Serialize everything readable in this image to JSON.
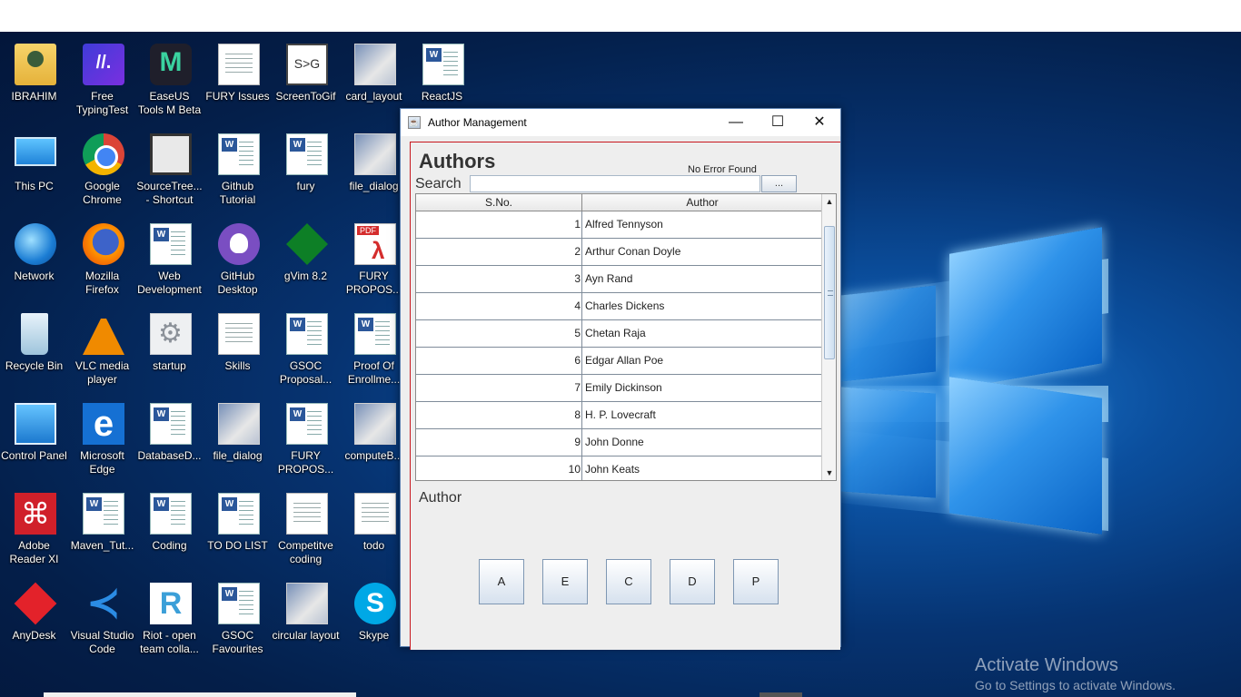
{
  "desktop": {
    "icons": [
      {
        "label": "IBRAHIM",
        "icon": "user-folder-icon"
      },
      {
        "label": "Free TypingTest",
        "icon": "typingtest-icon"
      },
      {
        "label": "EaseUS Tools M Beta",
        "icon": "easeus-icon"
      },
      {
        "label": "FURY Issues",
        "icon": "text-document-icon"
      },
      {
        "label": "ScreenToGif",
        "icon": "screentogif-icon"
      },
      {
        "label": "card_layout",
        "icon": "image-file-icon"
      },
      {
        "label": "ReactJS",
        "icon": "word-document-icon"
      },
      {
        "label": "This PC",
        "icon": "computer-icon"
      },
      {
        "label": "Google Chrome",
        "icon": "chrome-icon"
      },
      {
        "label": "SourceTree... - Shortcut",
        "icon": "sourcetree-icon"
      },
      {
        "label": "Github Tutorial",
        "icon": "word-document-icon"
      },
      {
        "label": "fury",
        "icon": "word-document-icon"
      },
      {
        "label": "file_dialog",
        "icon": "image-file-icon"
      },
      {
        "label": "Network",
        "icon": "network-icon"
      },
      {
        "label": "Mozilla Firefox",
        "icon": "firefox-icon"
      },
      {
        "label": "Web Development",
        "icon": "word-document-icon"
      },
      {
        "label": "GitHub Desktop",
        "icon": "github-icon"
      },
      {
        "label": "gVim 8.2",
        "icon": "vim-icon"
      },
      {
        "label": "FURY PROPOS...",
        "icon": "pdf-icon"
      },
      {
        "label": "Recycle Bin",
        "icon": "recycle-bin-icon"
      },
      {
        "label": "VLC media player",
        "icon": "vlc-icon"
      },
      {
        "label": "startup",
        "icon": "settings-file-icon"
      },
      {
        "label": "Skills",
        "icon": "text-document-icon"
      },
      {
        "label": "GSOC Proposal...",
        "icon": "word-document-icon"
      },
      {
        "label": "Proof Of Enrollme...",
        "icon": "word-document-icon"
      },
      {
        "label": "Control Panel",
        "icon": "control-panel-icon"
      },
      {
        "label": "Microsoft Edge",
        "icon": "edge-icon"
      },
      {
        "label": "DatabaseD...",
        "icon": "word-document-icon"
      },
      {
        "label": "file_dialog",
        "icon": "image-file-icon"
      },
      {
        "label": "FURY PROPOS...",
        "icon": "word-document-icon"
      },
      {
        "label": "computeB...",
        "icon": "image-file-icon"
      },
      {
        "label": "Adobe Reader XI",
        "icon": "acrobat-icon"
      },
      {
        "label": "Maven_Tut...",
        "icon": "word-document-icon"
      },
      {
        "label": "Coding",
        "icon": "word-document-icon"
      },
      {
        "label": "TO DO LIST",
        "icon": "word-document-icon"
      },
      {
        "label": "Competitve coding",
        "icon": "text-document-icon"
      },
      {
        "label": "todo",
        "icon": "text-document-icon"
      },
      {
        "label": "AnyDesk",
        "icon": "anydesk-icon"
      },
      {
        "label": "Visual Studio Code",
        "icon": "vscode-icon"
      },
      {
        "label": "Riot - open team colla...",
        "icon": "riot-icon"
      },
      {
        "label": "GSOC Favourites",
        "icon": "word-document-icon"
      },
      {
        "label": "circular layout",
        "icon": "image-file-icon"
      },
      {
        "label": "Skype",
        "icon": "skype-icon"
      }
    ],
    "activation": {
      "line1": "Activate Windows",
      "line2": "Go to Settings to activate Windows."
    }
  },
  "window": {
    "title": "Author Management",
    "controls": {
      "minimize": "—",
      "maximize": "☐",
      "close": "✕"
    },
    "heading": "Authors",
    "status": "No Error Found",
    "search": {
      "label": "Search",
      "value": "",
      "button": "..."
    },
    "table": {
      "columns": [
        "S.No.",
        "Author"
      ],
      "rows": [
        [
          "1",
          "Alfred Tennyson"
        ],
        [
          "2",
          "Arthur Conan Doyle"
        ],
        [
          "3",
          "Ayn Rand"
        ],
        [
          "4",
          "Charles Dickens"
        ],
        [
          "5",
          "Chetan Raja"
        ],
        [
          "6",
          "Edgar Allan Poe"
        ],
        [
          "7",
          "Emily Dickinson"
        ],
        [
          "8",
          "H. P. Lovecraft"
        ],
        [
          "9",
          "John Donne"
        ],
        [
          "10",
          "John Keats"
        ]
      ]
    },
    "detail_label": "Author",
    "buttons": [
      "A",
      "E",
      "C",
      "D",
      "P"
    ]
  }
}
